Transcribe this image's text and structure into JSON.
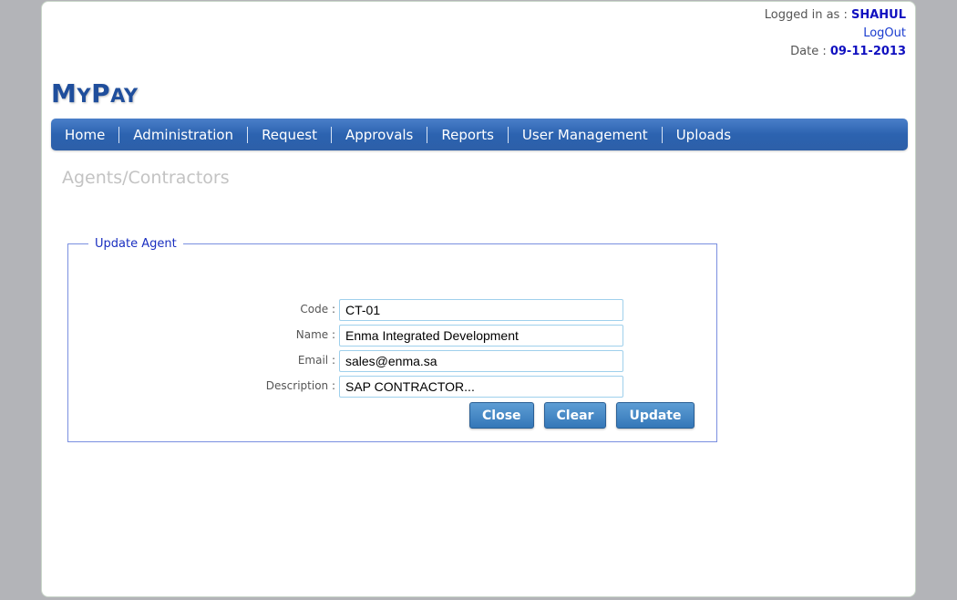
{
  "header": {
    "logged_in_label": "Logged in as : ",
    "username": "SHAHUL",
    "logout": "LogOut",
    "date_label": "Date : ",
    "date": "09-11-2013"
  },
  "logo": {
    "first_big": "M",
    "first_small": "Y",
    "second_big": "P",
    "second_small": "AY"
  },
  "nav": {
    "items": [
      "Home",
      "Administration",
      "Request",
      "Approvals",
      "Reports",
      "User Management",
      "Uploads"
    ]
  },
  "page_title": "Agents/Contractors",
  "form": {
    "legend": "Update Agent",
    "fields": [
      {
        "label": "Code :",
        "value": "CT-01"
      },
      {
        "label": "Name :",
        "value": "Enma Integrated Development"
      },
      {
        "label": "Email :",
        "value": "sales@enma.sa"
      },
      {
        "label": "Description :",
        "value": "SAP CONTRACTOR..."
      }
    ],
    "buttons": {
      "close": "Close",
      "clear": "Clear",
      "update": "Update"
    }
  }
}
